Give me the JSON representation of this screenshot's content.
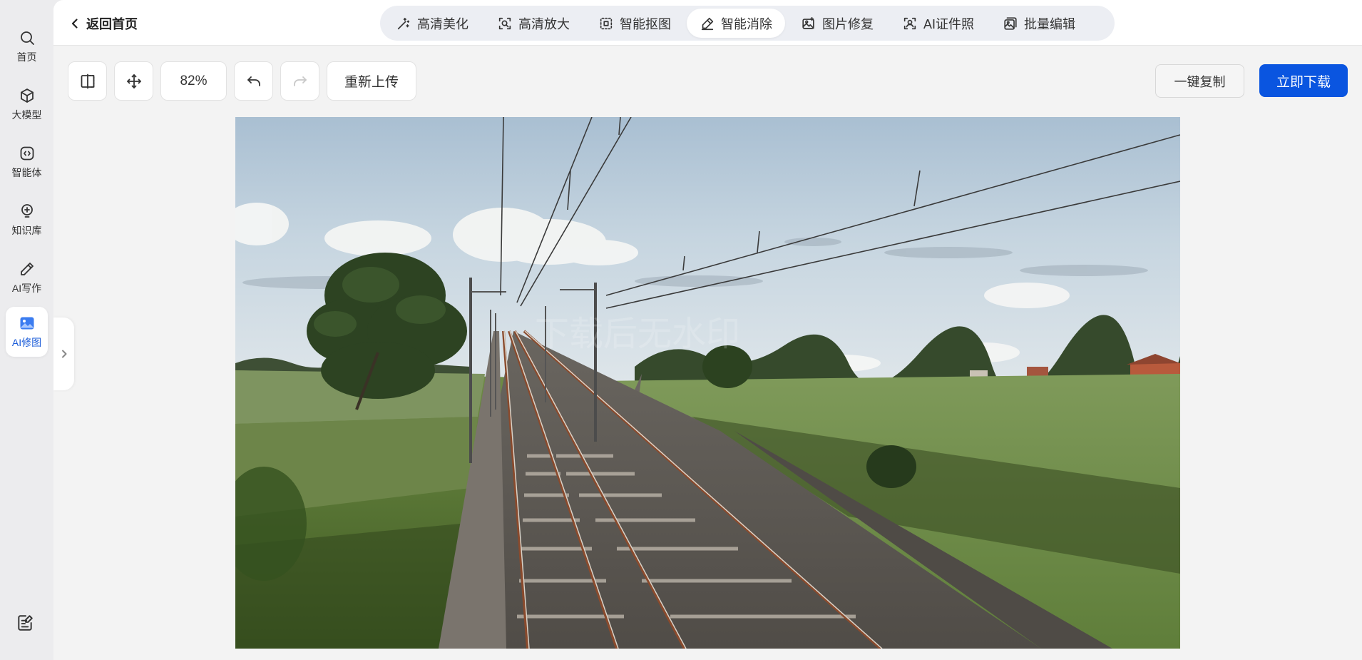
{
  "rail": {
    "items": [
      {
        "label": "首页",
        "icon": "search-icon"
      },
      {
        "label": "大模型",
        "icon": "cube-icon"
      },
      {
        "label": "智能体",
        "icon": "agent-icon"
      },
      {
        "label": "知识库",
        "icon": "bulb-icon"
      },
      {
        "label": "AI写作",
        "icon": "pen-icon"
      },
      {
        "label": "AI修图",
        "icon": "image-icon",
        "active": true
      }
    ],
    "bottom_icon": "notes-icon"
  },
  "header": {
    "back_label": "返回首页",
    "tabs": [
      {
        "label": "高清美化",
        "icon": "magic-wand-icon"
      },
      {
        "label": "高清放大",
        "icon": "zoom-frame-icon"
      },
      {
        "label": "智能抠图",
        "icon": "cutout-icon"
      },
      {
        "label": "智能消除",
        "icon": "eraser-icon",
        "active": true
      },
      {
        "label": "图片修复",
        "icon": "photo-repair-icon"
      },
      {
        "label": "AI证件照",
        "icon": "id-photo-icon"
      },
      {
        "label": "批量编辑",
        "icon": "batch-edit-icon"
      }
    ]
  },
  "toolbar": {
    "compare_icon": "compare-icon",
    "move_icon": "move-icon",
    "zoom": "82%",
    "undo_icon": "undo-icon",
    "redo_icon": "redo-icon",
    "reupload_label": "重新上传",
    "copy_label": "一键复制",
    "download_label": "立即下载"
  },
  "colors": {
    "accent": "#0a55e0",
    "active_text": "#1a5bd8"
  }
}
